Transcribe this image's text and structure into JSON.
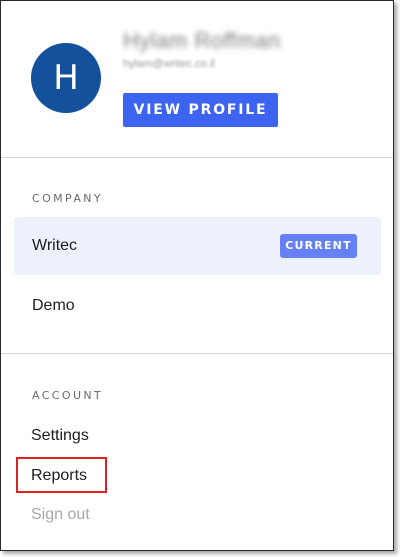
{
  "profile": {
    "avatar_initial": "H",
    "name": "Hylam Roffman",
    "email": "hylam@writec.co.il",
    "view_profile_label": "VIEW PROFILE"
  },
  "company_section": {
    "title": "COMPANY",
    "items": [
      {
        "label": "Writec",
        "badge": "CURRENT",
        "active": true
      },
      {
        "label": "Demo",
        "active": false
      }
    ]
  },
  "account_section": {
    "title": "ACCOUNT",
    "items": [
      {
        "label": "Settings"
      },
      {
        "label": "Reports",
        "highlighted": true
      },
      {
        "label": "Sign out",
        "muted": true
      }
    ]
  },
  "colors": {
    "avatar_bg": "#13519c",
    "primary_button": "#3c64f0",
    "badge_bg": "#6480f4",
    "active_item_bg": "#edf1fc",
    "highlight_border": "#e02020"
  }
}
